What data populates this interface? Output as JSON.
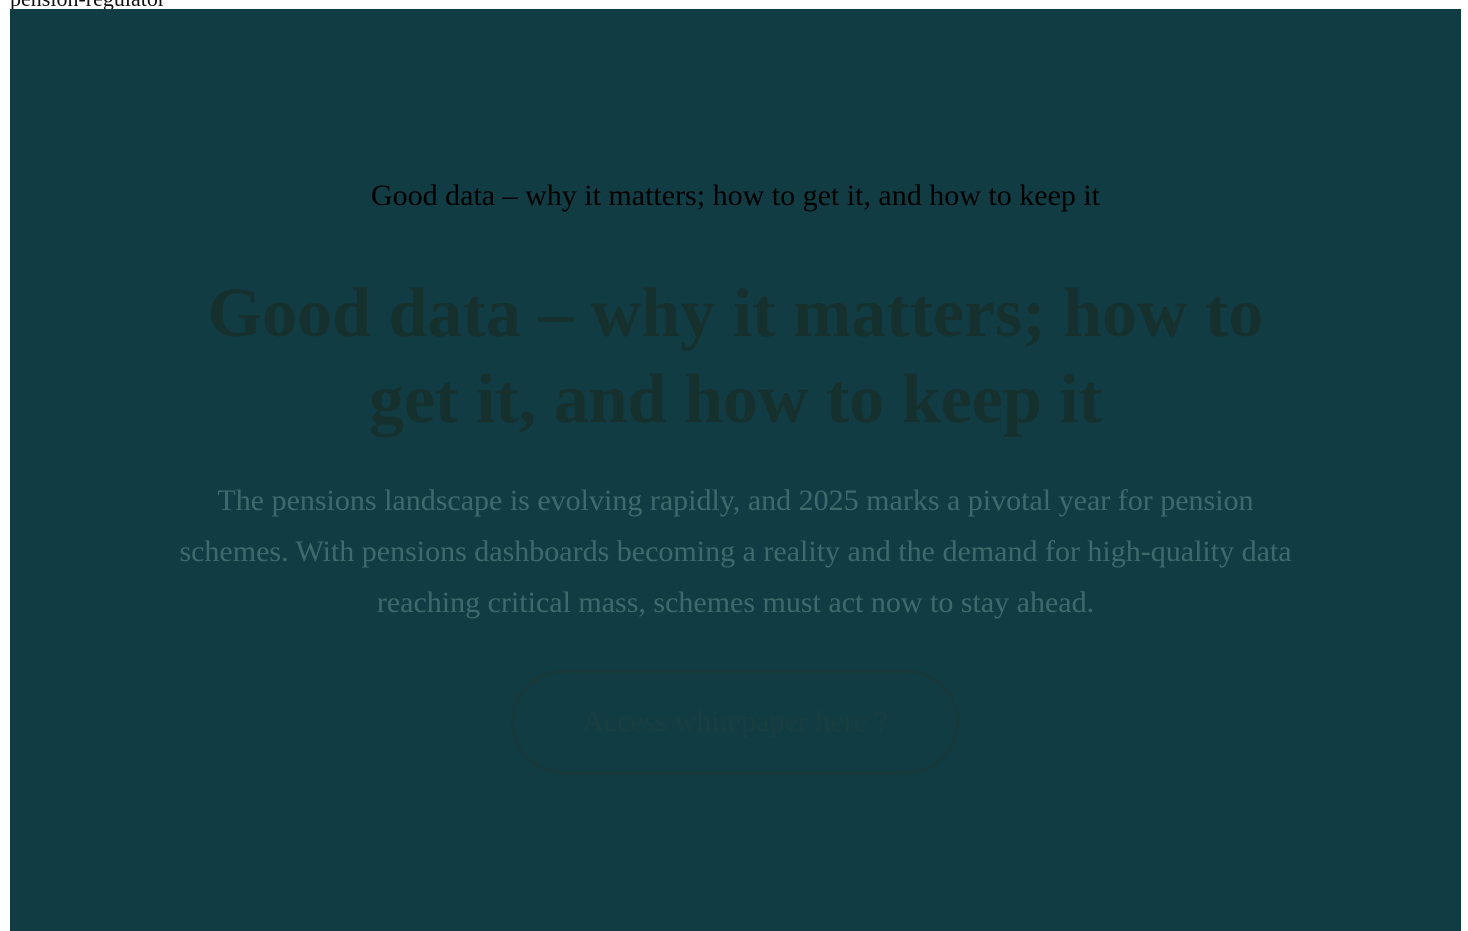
{
  "page": {
    "top_text": "pension-regulator"
  },
  "hero": {
    "eyebrow": "Good data – why it matters; how to get it, and how to keep it",
    "headline": "Good data – why it matters; how to get it, and how to keep it",
    "intro": "The pensions landscape is evolving rapidly, and 2025 marks a pivotal year for pension schemes. With pensions dashboards becoming a reality and the demand for high-quality data reaching critical mass, schemes must act now to stay ahead.",
    "cta_label": "Access whitepaper here ?"
  },
  "colors": {
    "hero_background": "#123c44",
    "headline": "#16302e",
    "intro_text": "#3f6a6c",
    "cta_border": "#18383a"
  }
}
